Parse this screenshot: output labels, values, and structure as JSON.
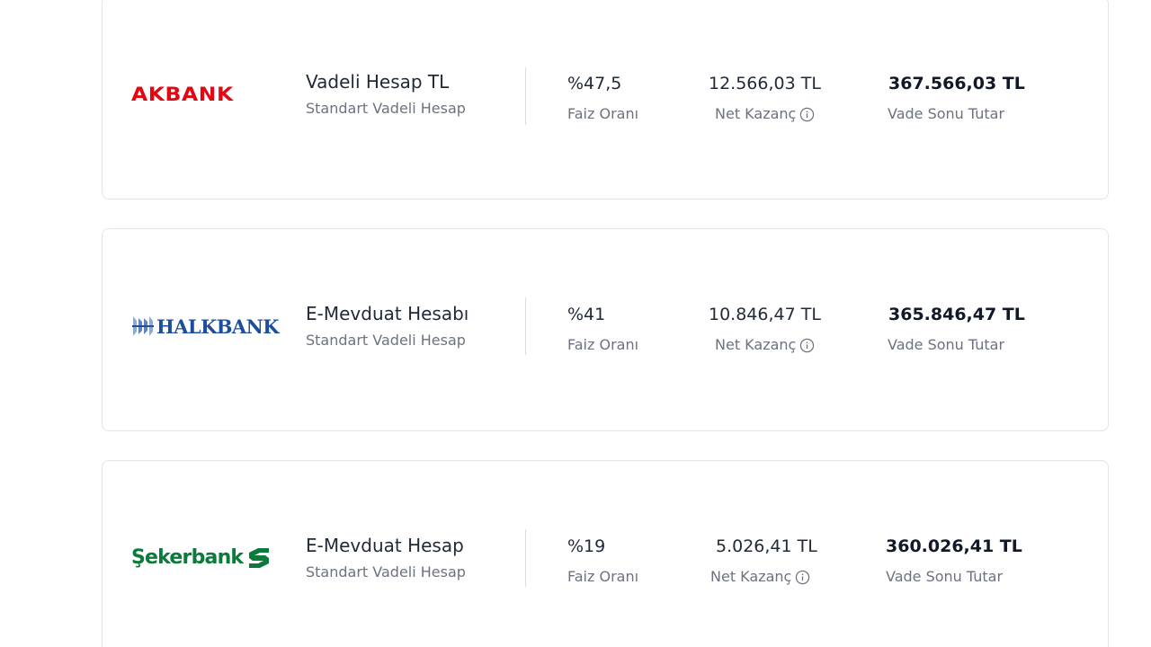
{
  "cards": [
    {
      "bank_logo": "AKBANK",
      "logo_color": "#e30613",
      "product_name": "Vadeli Hesap TL",
      "product_type": "Standart Vadeli Hesap",
      "rate_value": "%47,5",
      "rate_label": "Faiz Oranı",
      "net_value": "12.566,03 TL",
      "net_label": "Net Kazanç",
      "net_icon": "info-icon",
      "total_value": "367.566,03 TL",
      "total_label": "Vade Sonu Tutar"
    },
    {
      "bank_logo": "HALKBANK",
      "logo_color": "#1d4e9b",
      "product_name": "E-Mevduat Hesabı",
      "product_type": "Standart Vadeli Hesap",
      "rate_value": "%41",
      "rate_label": "Faiz Oranı",
      "net_value": "10.846,47 TL",
      "net_label": "Net Kazanç",
      "net_icon": "info-icon",
      "total_value": "365.846,47 TL",
      "total_label": "Vade Sonu Tutar"
    },
    {
      "bank_logo": "Şekerbank",
      "logo_color": "#0b7a3b",
      "product_name": "E-Mevduat Hesap",
      "product_type": "Standart Vadeli Hesap",
      "rate_value": "%19",
      "rate_label": "Faiz Oranı",
      "net_value": "5.026,41 TL",
      "net_label": "Net Kazanç",
      "net_icon": "info-icon",
      "total_value": "360.026,41 TL",
      "total_label": "Vade Sonu Tutar"
    }
  ]
}
